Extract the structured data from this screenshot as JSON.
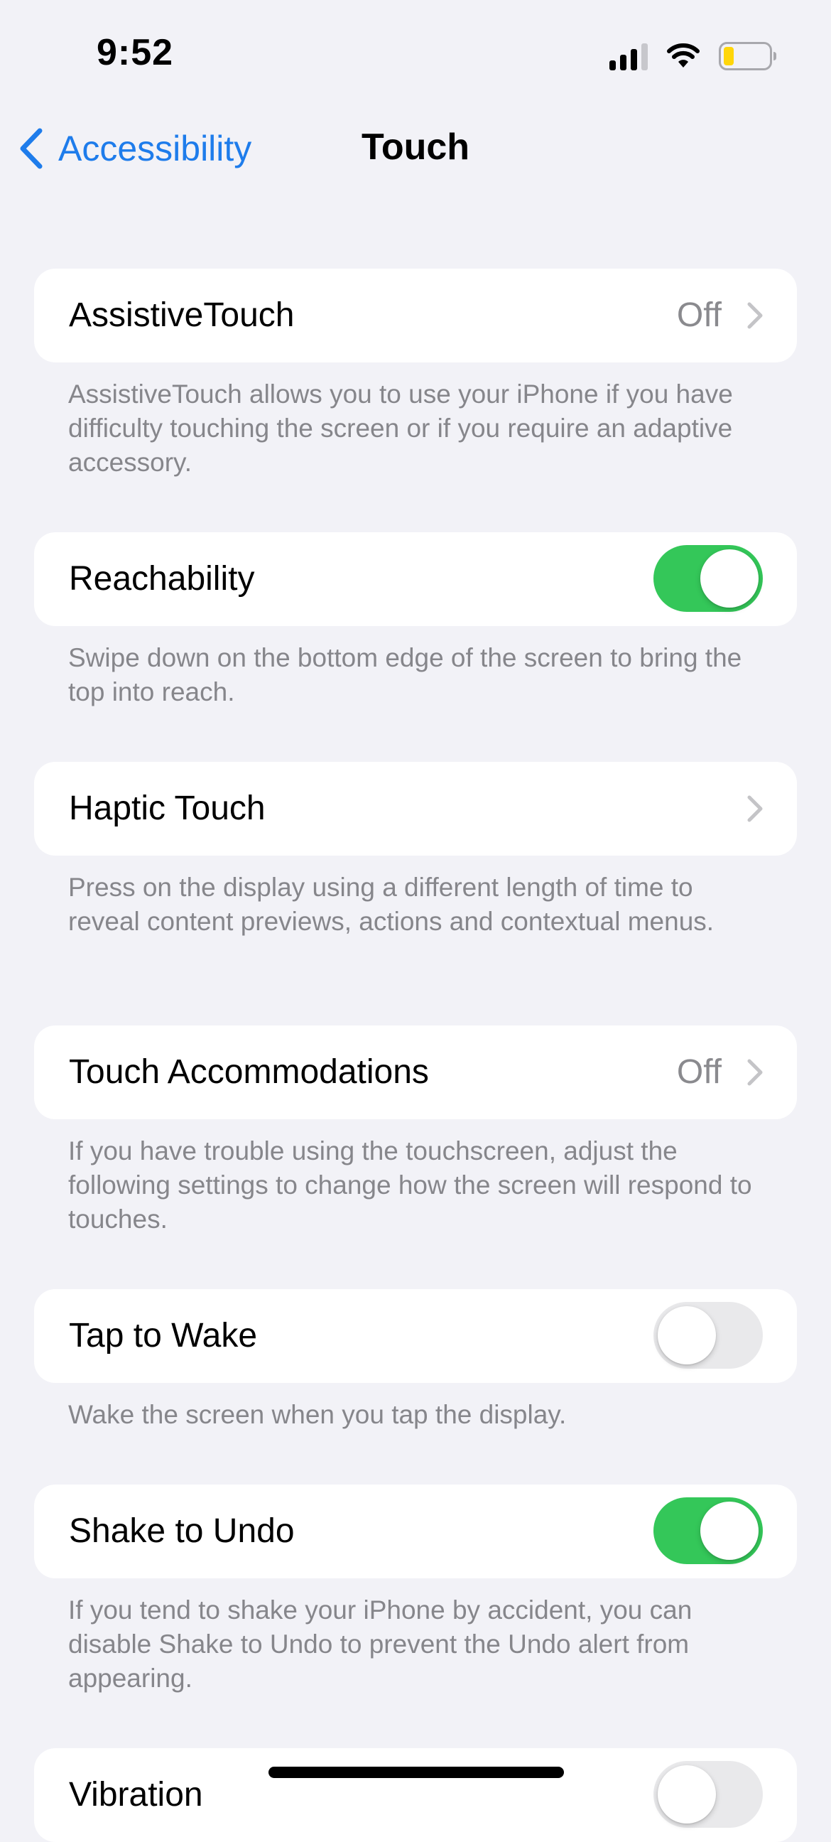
{
  "status_bar": {
    "time": "9:52",
    "signal_icon": "cellular-signal-icon",
    "wifi_icon": "wifi-icon",
    "battery_icon": "battery-low-icon"
  },
  "nav": {
    "back_label": "Accessibility",
    "back_icon": "chevron-left-icon",
    "title": "Touch"
  },
  "colors": {
    "background": "#F2F2F7",
    "accent": "#1E7CEB",
    "toggle_on": "#34C759",
    "toggle_off": "#E9E9EB",
    "battery_low": "#FFD60A"
  },
  "settings": [
    {
      "label": "AssistiveTouch",
      "value": "Off",
      "control": "disclosure",
      "footer": "AssistiveTouch allows you to use your iPhone if you have difficulty touching the screen or if you require an adaptive accessory."
    },
    {
      "label": "Reachability",
      "control": "toggle",
      "enabled": true,
      "footer": "Swipe down on the bottom edge of the screen to bring the top into reach."
    },
    {
      "label": "Haptic Touch",
      "value": "",
      "control": "disclosure",
      "footer": "Press on the display using a different length of time to reveal content previews, actions and contextual menus."
    },
    {
      "label": "Touch Accommodations",
      "value": "Off",
      "control": "disclosure",
      "footer": "If you have trouble using the touchscreen, adjust the following settings to change how the screen will respond to touches."
    },
    {
      "label": "Tap to Wake",
      "control": "toggle",
      "enabled": false,
      "footer": "Wake the screen when you tap the display."
    },
    {
      "label": "Shake to Undo",
      "control": "toggle",
      "enabled": true,
      "footer": "If you tend to shake your iPhone by accident, you can disable Shake to Undo to prevent the Undo alert from appearing."
    },
    {
      "label": "Vibration",
      "control": "toggle",
      "enabled": false,
      "footer": ""
    }
  ]
}
